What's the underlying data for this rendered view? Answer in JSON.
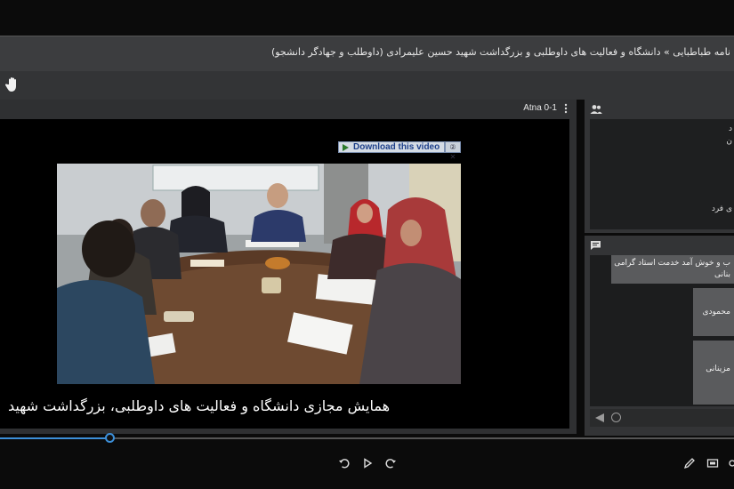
{
  "header": {
    "title": "نامه طباطبایی » دانشگاه و فعالیت های داوطلبی و بزرگداشت شهید حسین علیمرادی (داوطلب و جهادگر دانشجو)"
  },
  "video": {
    "participant_name": "Atna 0-1",
    "download_label": "Download this video",
    "badge": "② ✕",
    "caption": "همایش مجازی دانشگاه و فعالیت های داوطلبی، بزرگداشت شهید",
    "progress_fraction": 0.149
  },
  "users": {
    "rows": [
      "د",
      "ن",
      "ی فرد"
    ]
  },
  "chat": {
    "messages": [
      "ب و خوش آمد خدمت استاد گرامی",
      "بنانی",
      "محمودی",
      "مزینانی"
    ]
  },
  "icons": {
    "hand": "raise-hand-icon",
    "kebab": "more-options-icon",
    "users": "users-icon",
    "chat": "chat-icon"
  },
  "colors": {
    "accent": "#3c8fd8",
    "panel": "#333436",
    "topbar": "#3c3d3f"
  }
}
